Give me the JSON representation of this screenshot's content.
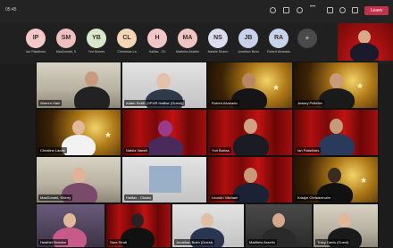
{
  "topbar": {
    "time": "05:45",
    "leave_label": "Leave",
    "icons": [
      "people-icon",
      "chat-icon",
      "reactions-icon",
      "more-icon",
      "camera-icon",
      "mic-icon",
      "share-icon"
    ]
  },
  "avatars": [
    {
      "initials": "IP",
      "name": "Ian Paladines",
      "color": "#f4c8c8"
    },
    {
      "initials": "SM",
      "name": "MacDonald, S",
      "color": "#f0c0c0"
    },
    {
      "initials": "YB",
      "name": "Yuri Bomes",
      "color": "#d8e8c8"
    },
    {
      "initials": "CL",
      "name": "Christmas La",
      "color": "#f2d6b6"
    },
    {
      "initials": "H",
      "name": "Halifax - Ch",
      "color": "#f2c6c6"
    },
    {
      "initials": "MA",
      "name": "Matthew Asselin",
      "color": "#f0c4c0"
    },
    {
      "initials": "NS",
      "name": "Natalie Sharm",
      "color": "#dcdcf0"
    },
    {
      "initials": "JB",
      "name": "Jonathan Bulm",
      "color": "#c8d0ea"
    },
    {
      "initials": "RA",
      "name": "Robert Alvarado",
      "color": "#c8d4ec"
    }
  ],
  "more_label": "+",
  "tiles": [
    {
      "name": "Warren Hale"
    },
    {
      "name": "Adam Smith (SPUR Halifax (Guest))"
    },
    {
      "name": "Robert Alvarado"
    },
    {
      "name": "Jessey Pelletier"
    },
    {
      "name": "Christine Lacas"
    },
    {
      "name": "Nabila Vawell"
    },
    {
      "name": "Yuri Bartas"
    },
    {
      "name": "Ian Paladines"
    },
    {
      "name": "MacDonald, Sherry"
    },
    {
      "name": "Halifax - Citadel"
    },
    {
      "name": "Leonid / Michael"
    },
    {
      "name": "Kristyn Christenholm"
    },
    {
      "name": "Heather Braxton"
    },
    {
      "name": "Sara Strati"
    },
    {
      "name": "Jonathan Bulm (Guest)"
    },
    {
      "name": "Matthew Asselin"
    },
    {
      "name": "Tracy Davis (Guest)"
    }
  ]
}
